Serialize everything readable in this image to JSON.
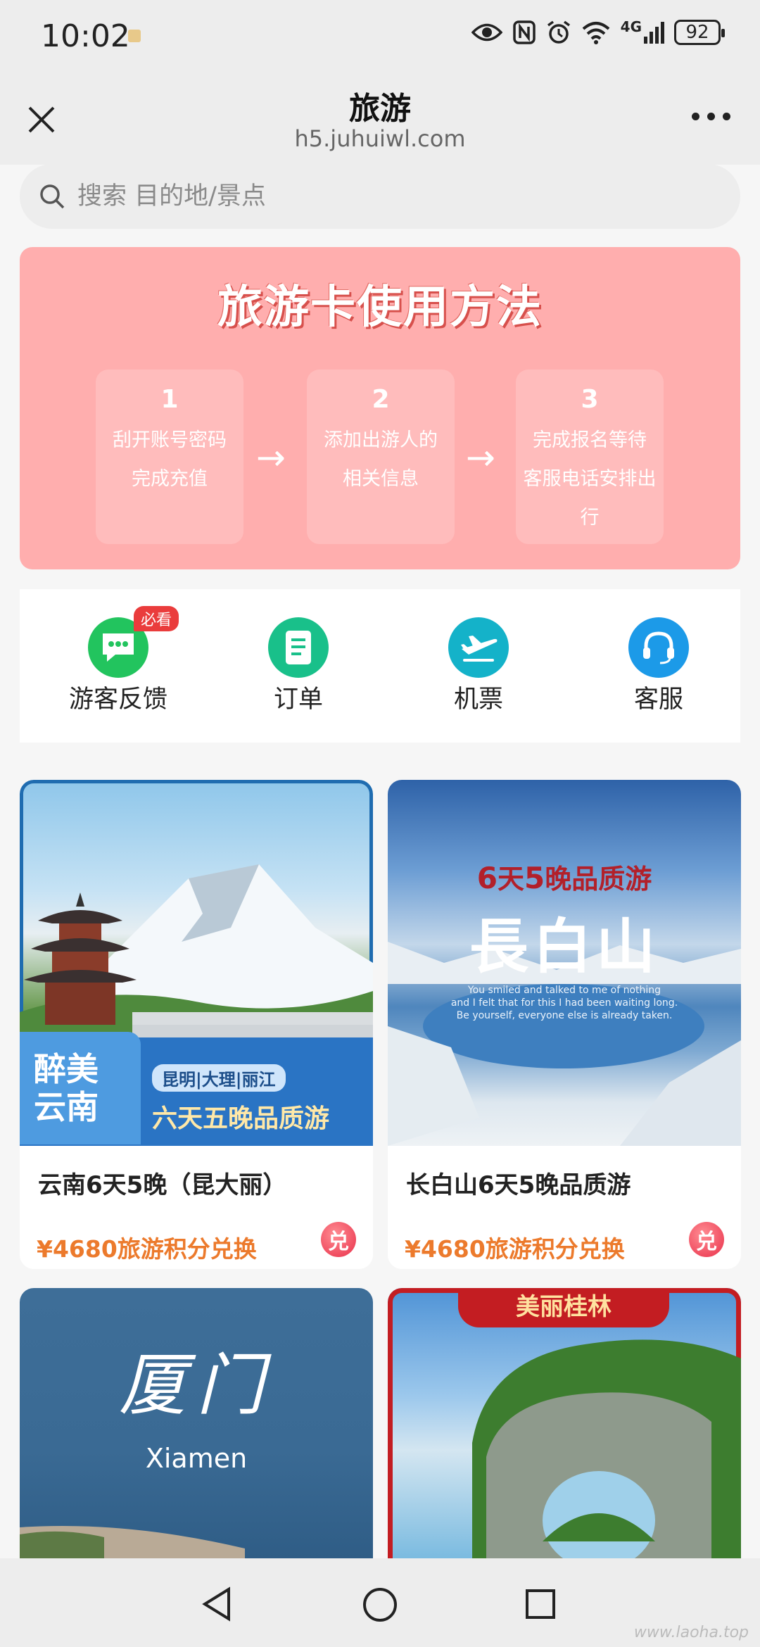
{
  "status_bar": {
    "time": "10:02",
    "network": "4G",
    "battery": "92"
  },
  "header": {
    "title": "旅游",
    "subtitle": "h5.juhuiwl.com"
  },
  "search": {
    "placeholder": "搜索 目的地/景点"
  },
  "banner": {
    "title": "旅游卡使用方法",
    "steps": [
      {
        "num": "1",
        "line1": "刮开账号密码",
        "line2": "完成充值"
      },
      {
        "num": "2",
        "line1": "添加出游人的",
        "line2": "相关信息"
      },
      {
        "num": "3",
        "line1": "完成报名等待",
        "line2": "客服电话安排出行"
      }
    ],
    "arrow": "→",
    "color": "#ffaeae"
  },
  "quick_nav": [
    {
      "label": "游客反馈",
      "icon": "chat-icon",
      "badge": "必看",
      "color": "#22c45e"
    },
    {
      "label": "订单",
      "icon": "order-icon",
      "color": "#19c08a"
    },
    {
      "label": "机票",
      "icon": "plane-icon",
      "color": "#14b2c9"
    },
    {
      "label": "客服",
      "icon": "headset-icon",
      "color": "#1c9ae8"
    }
  ],
  "products": [
    {
      "name": "云南6天5晚（昆大丽）",
      "price": "¥4680旅游积分兑换",
      "exchange": "兑",
      "img": {
        "title_top": "醉美",
        "title_bottom": "云南",
        "cities": [
          "昆明",
          "大理",
          "丽江"
        ],
        "tagline": "六天五晚品质游"
      }
    },
    {
      "name": "长白山6天5晚品质游",
      "price": "¥4680旅游积分兑换",
      "exchange": "兑",
      "img": {
        "headline_num1": "6",
        "headline_t1": "天",
        "headline_num2": "5",
        "headline_t2": "晚品质游",
        "title": "長白山",
        "quote1": "You smiled and talked to me of nothing",
        "quote2": "and I felt that for this I had been waiting long.",
        "quote3": "Be yourself, everyone else is already taken."
      }
    },
    {
      "img": {
        "title": "厦门",
        "subtitle": "Xiamen"
      }
    },
    {
      "img": {
        "ribbon": "美丽桂林"
      }
    }
  ],
  "watermark": "www.laoha.top",
  "accent_price": "#ec7a2c"
}
